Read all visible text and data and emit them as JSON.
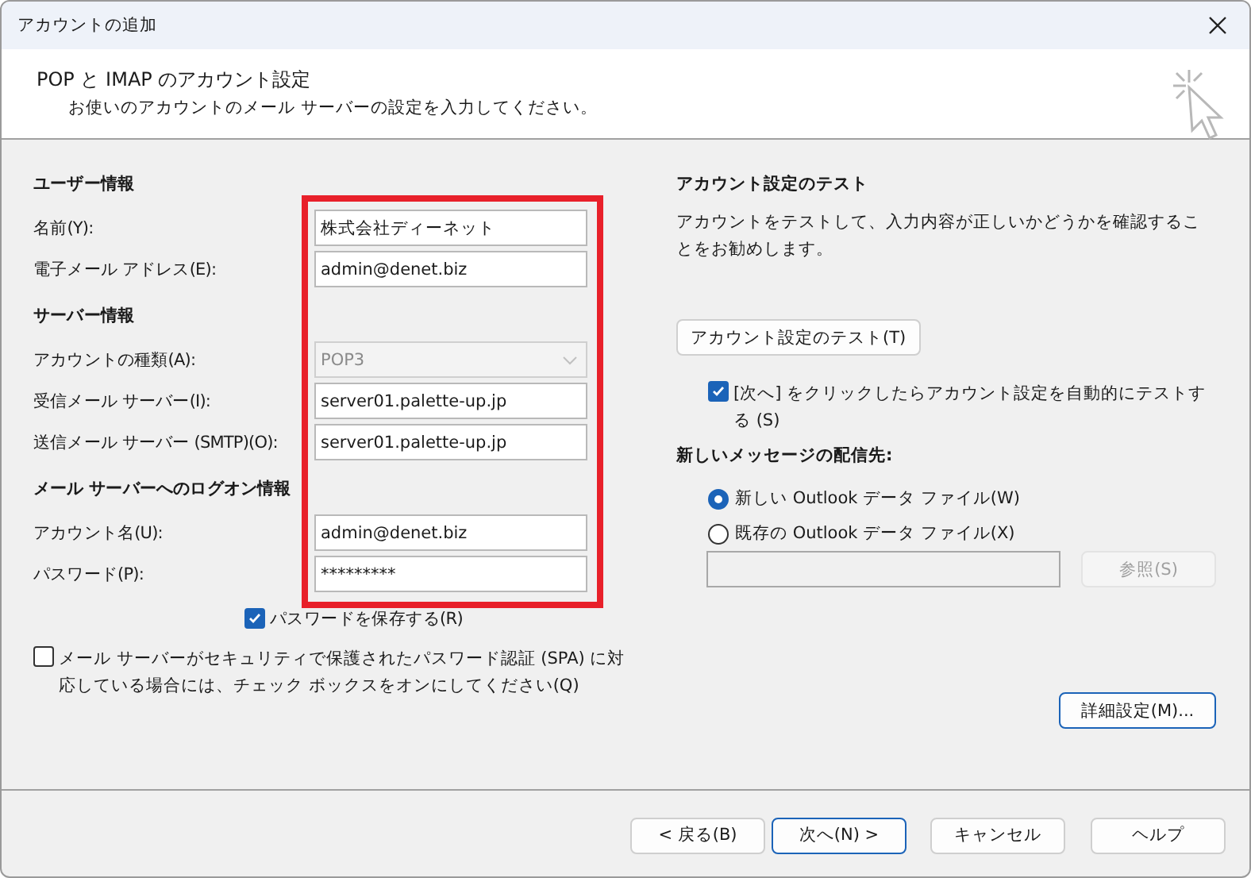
{
  "window": {
    "title": "アカウントの追加"
  },
  "header": {
    "title": "POP と IMAP のアカウント設定",
    "subtitle": "お使いのアカウントのメール サーバーの設定を入力してください。"
  },
  "sections": [
    {
      "heading": "ユーザー情報",
      "fields": [
        {
          "kind": "text",
          "label": "名前(Y):",
          "value": "株式会社ディーネット",
          "disabled": false
        },
        {
          "kind": "text",
          "label": "電子メール アドレス(E):",
          "value": "admin@denet.biz",
          "disabled": false
        }
      ]
    },
    {
      "heading": "サーバー情報",
      "fields": [
        {
          "kind": "select",
          "label": "アカウントの種類(A):",
          "value": "POP3",
          "disabled": true
        },
        {
          "kind": "text",
          "label": "受信メール サーバー(I):",
          "value": "server01.palette-up.jp",
          "disabled": false
        },
        {
          "kind": "text",
          "label": "送信メール サーバー (SMTP)(O):",
          "value": "server01.palette-up.jp",
          "disabled": false
        }
      ]
    },
    {
      "heading": "メール サーバーへのログオン情報",
      "fields": [
        {
          "kind": "text",
          "label": "アカウント名(U):",
          "value": "admin@denet.biz",
          "disabled": false
        },
        {
          "kind": "text",
          "label": "パスワード(P):",
          "value": "*********",
          "disabled": false
        }
      ]
    }
  ],
  "annotation": {
    "kind": "frame",
    "color": "#e8202a"
  },
  "save_password": {
    "label": "パスワードを保存する(R)",
    "checked": true
  },
  "spa": {
    "label": "メール サーバーがセキュリティで保護されたパスワード認証 (SPA) に対応している場合には、チェック ボックスをオンにしてください(Q)",
    "checked": false
  },
  "account_test": {
    "heading": "アカウント設定のテスト",
    "description": "アカウントをテストして、入力内容が正しいかどうかを確認することをお勧めします。",
    "button": "アカウント設定のテスト(T)",
    "auto_test": {
      "label": "[次へ] をクリックしたらアカウント設定を自動的にテストする (S)",
      "checked": true
    }
  },
  "delivery": {
    "heading": "新しいメッセージの配信先:",
    "options": [
      {
        "label": "新しい Outlook データ ファイル(W)",
        "selected": true
      },
      {
        "label": "既存の Outlook データ ファイル(X)",
        "selected": false
      }
    ],
    "file_field": {
      "disabled": true
    },
    "browse_button": {
      "label": "参照(S)",
      "disabled": true
    }
  },
  "advanced_button": "詳細設定(M)...",
  "buttons": [
    {
      "label": "< 戻る(B)",
      "default": false
    },
    {
      "label": "次へ(N) >",
      "default": true
    },
    {
      "label": "キャンセル",
      "default": false
    },
    {
      "label": "ヘルプ",
      "default": false
    }
  ]
}
